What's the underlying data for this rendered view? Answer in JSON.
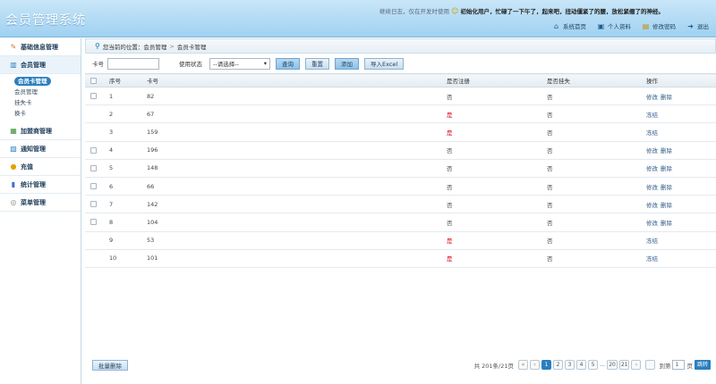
{
  "header": {
    "title": "会员管理系统",
    "notice_prefix": "继续日志，仅在开发时使用",
    "notice_text": "初始化用户，忙碌了一下午了，起来吧，扭动僵紧了的腰，放松紧绷了的神经。",
    "links": [
      {
        "icon": "home-icon",
        "label": "系统首页"
      },
      {
        "icon": "profile-icon",
        "label": "个人资料"
      },
      {
        "icon": "lock-icon",
        "label": "修改密码"
      },
      {
        "icon": "exit-icon",
        "label": "退出"
      }
    ]
  },
  "sidebar": {
    "groups": [
      {
        "label": "基础信息管理",
        "icon": "edit-icon",
        "icon_color": "#d9702a"
      },
      {
        "label": "会员管理",
        "icon": "users-icon",
        "icon_color": "#2a7fbf",
        "items": [
          "会员卡管理",
          "会员管理",
          "挂失卡",
          "换卡"
        ]
      },
      {
        "label": "加盟商管理",
        "icon": "store-icon",
        "icon_color": "#3a8f3a"
      },
      {
        "label": "通知管理",
        "icon": "notice-icon",
        "icon_color": "#2a7fbf"
      },
      {
        "label": "充值",
        "icon": "coins-icon",
        "icon_color": "#e0a400"
      },
      {
        "label": "统计管理",
        "icon": "chart-icon",
        "icon_color": "#3b6fc9"
      },
      {
        "label": "菜单管理",
        "icon": "menu-icon",
        "icon_color": "#888888"
      }
    ]
  },
  "breadcrumb": {
    "prefix": "您当前的位置：",
    "items": [
      "会员管理",
      "会员卡管理"
    ]
  },
  "filter": {
    "card_label": "卡号",
    "card_value": "",
    "status_label": "使用状态",
    "status_selected": "--请选择--",
    "query": "查询",
    "reset": "重置",
    "add": "添加",
    "import": "导入Excel"
  },
  "table": {
    "headers": [
      "序号",
      "卡号",
      "是否注册",
      "是否挂失",
      "操作"
    ],
    "rows": [
      {
        "no": "1",
        "card": "82",
        "reg": "否",
        "lost": "否",
        "actions": [
          "修改",
          "删除"
        ],
        "checkbox": true
      },
      {
        "no": "2",
        "card": "67",
        "reg": "是",
        "lost": "否",
        "actions": [
          "冻结"
        ],
        "checkbox": false
      },
      {
        "no": "3",
        "card": "159",
        "reg": "是",
        "lost": "否",
        "actions": [
          "冻结"
        ],
        "checkbox": false
      },
      {
        "no": "4",
        "card": "196",
        "reg": "否",
        "lost": "否",
        "actions": [
          "修改",
          "删除"
        ],
        "checkbox": true
      },
      {
        "no": "5",
        "card": "148",
        "reg": "否",
        "lost": "否",
        "actions": [
          "修改",
          "删除"
        ],
        "checkbox": true
      },
      {
        "no": "6",
        "card": "66",
        "reg": "否",
        "lost": "否",
        "actions": [
          "修改",
          "删除"
        ],
        "checkbox": true
      },
      {
        "no": "7",
        "card": "142",
        "reg": "否",
        "lost": "否",
        "actions": [
          "修改",
          "删除"
        ],
        "checkbox": true
      },
      {
        "no": "8",
        "card": "104",
        "reg": "否",
        "lost": "否",
        "actions": [
          "修改",
          "删除"
        ],
        "checkbox": true
      },
      {
        "no": "9",
        "card": "53",
        "reg": "是",
        "lost": "否",
        "actions": [
          "冻结"
        ],
        "checkbox": false
      },
      {
        "no": "10",
        "card": "101",
        "reg": "是",
        "lost": "否",
        "actions": [
          "冻结"
        ],
        "checkbox": false
      }
    ]
  },
  "footer": {
    "batch_delete": "批量删除",
    "summary": "共 201条/21页",
    "pages": [
      "1",
      "2",
      "3",
      "4",
      "5",
      "...",
      "20",
      "21"
    ],
    "current_page": "1",
    "goto_label": "到第",
    "goto_value": "1",
    "page_unit": "页",
    "go": "跳转"
  },
  "colors": {
    "accent": "#2a7fbf",
    "header_bg": "#9fd1f1",
    "yes_red": "#d9000d"
  }
}
